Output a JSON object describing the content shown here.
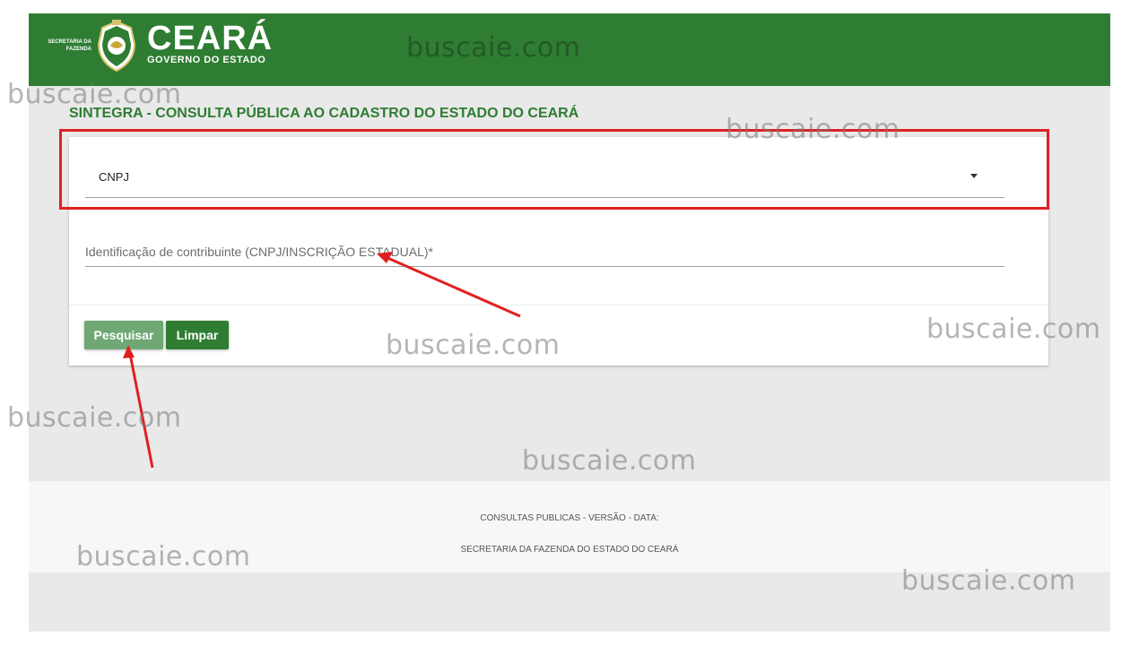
{
  "header": {
    "secretaria_line1": "SECRETARIA DA",
    "secretaria_line2": "FAZENDA",
    "brand_title": "CEARÁ",
    "brand_subtitle": "GOVERNO DO ESTADO",
    "background_color": "#2e7d32"
  },
  "page": {
    "title": "SINTEGRA - CONSULTA PÚBLICA AO CADASTRO DO ESTADO DO CEARÁ"
  },
  "form": {
    "search_type": {
      "selected": "CNPJ",
      "icon": "dropdown-arrow-icon"
    },
    "taxpayer_id": {
      "label": "Identificação de contribuinte (CNPJ/INSCRIÇÃO ESTADUAL)*",
      "value": ""
    },
    "buttons": {
      "search_label": "Pesquisar",
      "clear_label": "Limpar"
    }
  },
  "footer": {
    "line1": "CONSULTAS PUBLICAS - VERSÃO - DATA:",
    "line2": "SECRETARIA DA FAZENDA DO ESTADO DO CEARÁ"
  },
  "watermark": {
    "text": "buscaie.com"
  },
  "annotations": {
    "highlight_color": "#e02020"
  }
}
